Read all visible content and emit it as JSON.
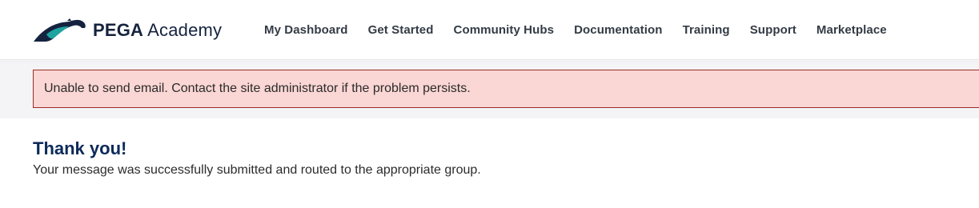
{
  "header": {
    "logo": {
      "brand": "PEGA",
      "product": "Academy",
      "icon": "pega-horse-logo-icon",
      "colors": {
        "navy": "#15233f",
        "teal": "#1fa3a0"
      }
    },
    "nav": [
      {
        "label": "My Dashboard"
      },
      {
        "label": "Get Started"
      },
      {
        "label": "Community Hubs"
      },
      {
        "label": "Documentation"
      },
      {
        "label": "Training"
      },
      {
        "label": "Support"
      },
      {
        "label": "Marketplace"
      }
    ]
  },
  "alert": {
    "message": "Unable to send email. Contact the site administrator if the problem persists.",
    "colors": {
      "background": "#fad6d4",
      "border": "#9b2b25"
    }
  },
  "main": {
    "title": "Thank you!",
    "message": "Your message was successfully submitted and routed to the appropriate group."
  }
}
